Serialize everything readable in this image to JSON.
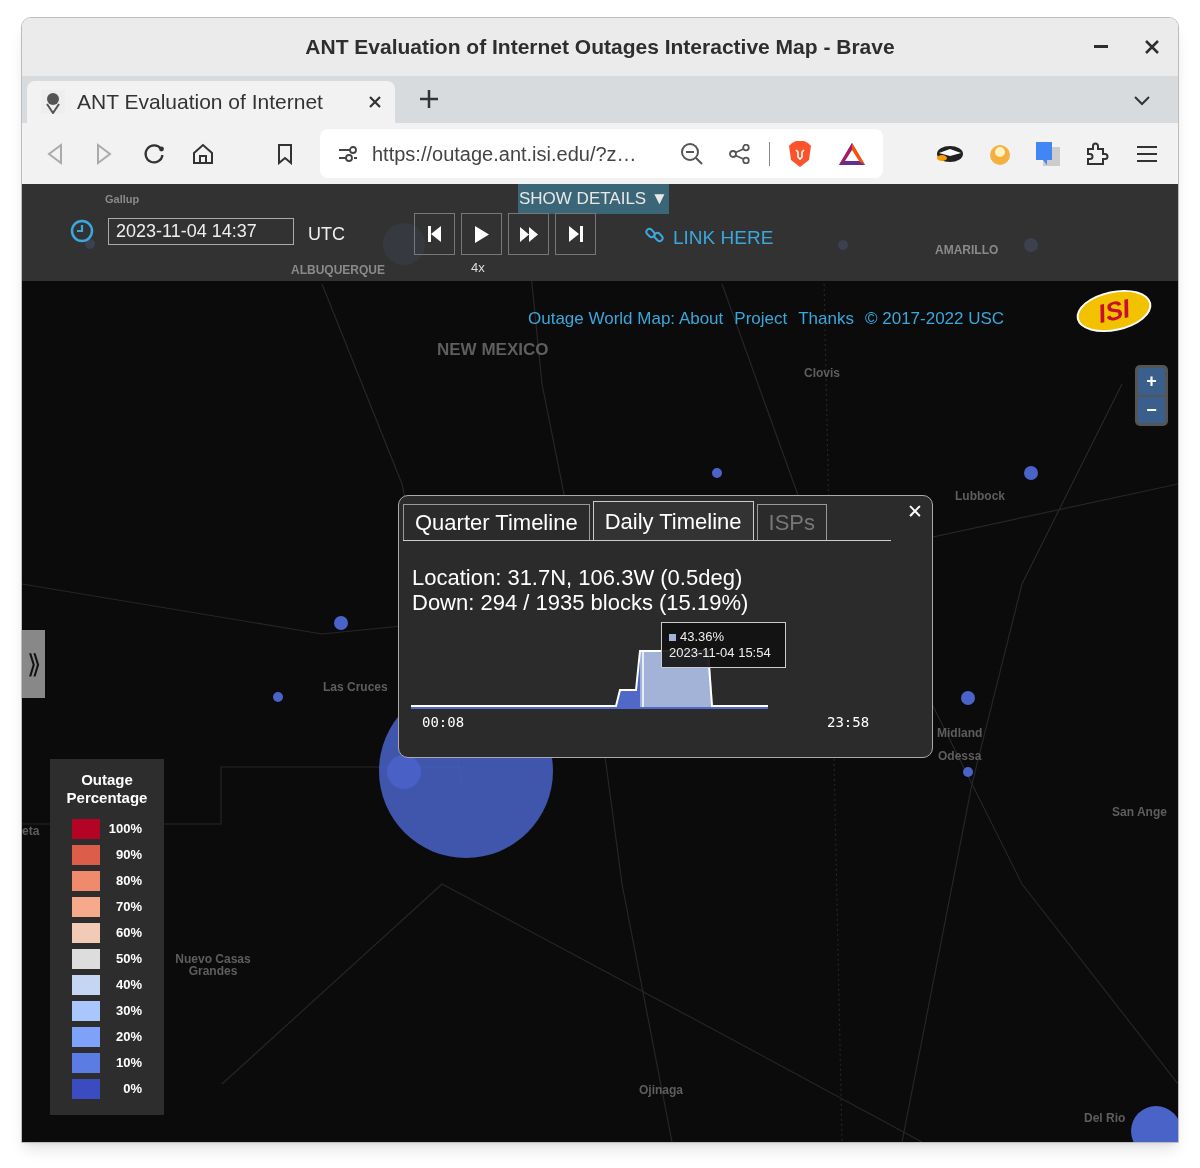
{
  "window": {
    "title": "ANT Evaluation of Internet Outages Interactive Map - Brave"
  },
  "tabs": [
    {
      "label": "ANT Evaluation of Internet",
      "selected": true
    }
  ],
  "address_bar": {
    "url": "https://outage.ant.isi.edu/?z…"
  },
  "controls": {
    "details_button": {
      "label": "SHOW DETAILS",
      "caret": "▼"
    },
    "time": "2023-11-04 14:37",
    "timezone": "UTC",
    "speed": "4x",
    "link": "LINK HERE"
  },
  "footer_links": [
    "Outage World Map: About",
    "Project",
    "Thanks",
    "© 2017-2022 USC"
  ],
  "logo": "ISI",
  "zoom_controls": [
    "+",
    "−"
  ],
  "map_labels": [
    "Gallup",
    "ALBUQUERQUE",
    "AMARILLO",
    "NEW MEXICO",
    "Clovis",
    "Lubbock",
    "Las Cruces",
    "Midland",
    "Odessa",
    "San Ange",
    "eta",
    "Nuevo Casas Grandes",
    "Ojinaga",
    "Del Rio"
  ],
  "popup": {
    "tabs": [
      {
        "label": "Quarter Timeline",
        "selected": false,
        "disabled": false
      },
      {
        "label": "Daily Timeline",
        "selected": true,
        "disabled": false
      },
      {
        "label": "ISPs",
        "selected": false,
        "disabled": true
      }
    ],
    "close": "✕",
    "lines": [
      "Location: 31.7N, 106.3W (0.5deg)",
      "Down: 294 / 1935 blocks (15.19%)"
    ],
    "tooltip": {
      "value": "43.36%",
      "time": "2023-11-04 15:54"
    },
    "axis_start": "00:08",
    "axis_end": "23:58"
  },
  "legend": {
    "title": "Outage Percentage",
    "items": [
      {
        "label": "100%",
        "color": "#b40426"
      },
      {
        "label": "90%",
        "color": "#dc5d4a"
      },
      {
        "label": "80%",
        "color": "#f08a6c"
      },
      {
        "label": "70%",
        "color": "#f6a98b"
      },
      {
        "label": "60%",
        "color": "#f2cbb7"
      },
      {
        "label": "50%",
        "color": "#dddddd"
      },
      {
        "label": "40%",
        "color": "#c5d6f2"
      },
      {
        "label": "30%",
        "color": "#aac7fd"
      },
      {
        "label": "20%",
        "color": "#7ea1fa"
      },
      {
        "label": "10%",
        "color": "#5b7ce3"
      },
      {
        "label": "0%",
        "color": "#3b4cc0"
      }
    ]
  },
  "side_toggle": "⟫"
}
